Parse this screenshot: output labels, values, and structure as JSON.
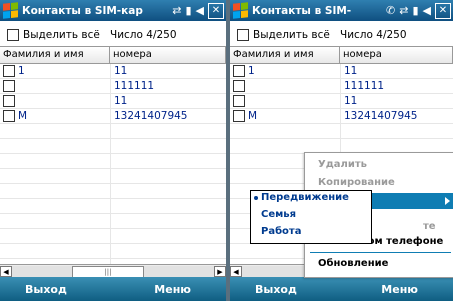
{
  "left_screen": {
    "title": "Контакты в SIM-кар",
    "status_icons": [
      "sync-icon",
      "signal-icon",
      "volume-icon",
      "close-icon"
    ],
    "select_all_label": "Выделить всё",
    "count_label": "Число 4/250",
    "columns": [
      "Фамилия и имя",
      "номера"
    ],
    "rows": [
      {
        "name": "1",
        "number": "11"
      },
      {
        "name": "",
        "number": "111111"
      },
      {
        "name": "",
        "number": "11"
      },
      {
        "name": "M",
        "number": "13241407945"
      }
    ],
    "softkey_left": "Выход",
    "softkey_right": "Меню"
  },
  "right_screen": {
    "title": "Контакты в SIM-",
    "status_icons": [
      "phone-icon",
      "sync-icon",
      "signal-icon",
      "volume-icon",
      "close-icon"
    ],
    "select_all_label": "Выделить всё",
    "count_label": "Число 4/250",
    "columns": [
      "Фамилия и имя",
      "номера"
    ],
    "rows": [
      {
        "name": "1",
        "number": "11"
      },
      {
        "name": "",
        "number": "111111"
      },
      {
        "name": "",
        "number": "11"
      },
      {
        "name": "M",
        "number": "13241407945"
      }
    ],
    "softkey_left": "Выход",
    "softkey_right": "Меню",
    "menu": {
      "items": [
        {
          "label": "Удалить",
          "enabled": false
        },
        {
          "label": "Копирование",
          "enabled": false
        },
        {
          "label": "",
          "enabled": true,
          "highlighted": true,
          "has_submenu": true
        },
        {
          "label": "те",
          "enabled": false
        },
        {
          "label": "мобильном телефоне",
          "enabled": true
        },
        {
          "label": "Обновление",
          "enabled": true
        }
      ]
    },
    "submenu": {
      "items": [
        {
          "label": "Передвижение",
          "selected": true
        },
        {
          "label": "Семья",
          "selected": false
        },
        {
          "label": "Работа",
          "selected": false
        }
      ]
    }
  },
  "colors": {
    "titlebar": "#1a5f92",
    "softbar": "#1a7199",
    "highlight": "#0f7db3",
    "link_text": "#00238a"
  }
}
